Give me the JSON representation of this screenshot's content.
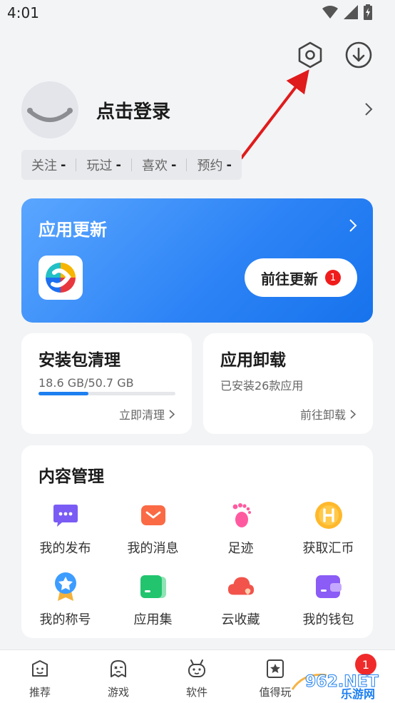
{
  "status_bar": {
    "time": "4:01",
    "icons": [
      "wifi-icon",
      "signal-icon",
      "battery-icon"
    ]
  },
  "header": {
    "icons": [
      "settings-icon",
      "download-icon"
    ]
  },
  "profile": {
    "login_text": "点击登录"
  },
  "stats": [
    {
      "label": "关注",
      "value": "-"
    },
    {
      "label": "玩过",
      "value": "-"
    },
    {
      "label": "喜欢",
      "value": "-"
    },
    {
      "label": "预约",
      "value": "-"
    }
  ],
  "update": {
    "title": "应用更新",
    "button": "前往更新",
    "badge": "1",
    "accent": "#2b82f5"
  },
  "package_clean": {
    "title": "安装包清理",
    "usage": "18.6 GB/50.7 GB",
    "used_fraction": 0.367,
    "action": "立即清理"
  },
  "uninstall": {
    "title": "应用卸载",
    "subtitle": "已安装26款应用",
    "action": "前往卸载"
  },
  "content": {
    "title": "内容管理",
    "items": [
      {
        "label": "我的发布",
        "icon": "chat-bubble-icon"
      },
      {
        "label": "我的消息",
        "icon": "mail-icon"
      },
      {
        "label": "足迹",
        "icon": "footprint-icon"
      },
      {
        "label": "获取汇币",
        "icon": "coin-icon"
      },
      {
        "label": "我的称号",
        "icon": "medal-icon"
      },
      {
        "label": "应用集",
        "icon": "collection-icon"
      },
      {
        "label": "云收藏",
        "icon": "cloud-heart-icon"
      },
      {
        "label": "我的钱包",
        "icon": "wallet-icon"
      }
    ]
  },
  "tabs": [
    {
      "label": "推荐",
      "icon": "recommend-icon"
    },
    {
      "label": "游戏",
      "icon": "game-icon"
    },
    {
      "label": "软件",
      "icon": "software-icon"
    },
    {
      "label": "值得玩",
      "icon": "star-icon"
    }
  ],
  "tab_badge": "1",
  "watermark": {
    "text1": "962.NET",
    "text2": "乐游网"
  }
}
